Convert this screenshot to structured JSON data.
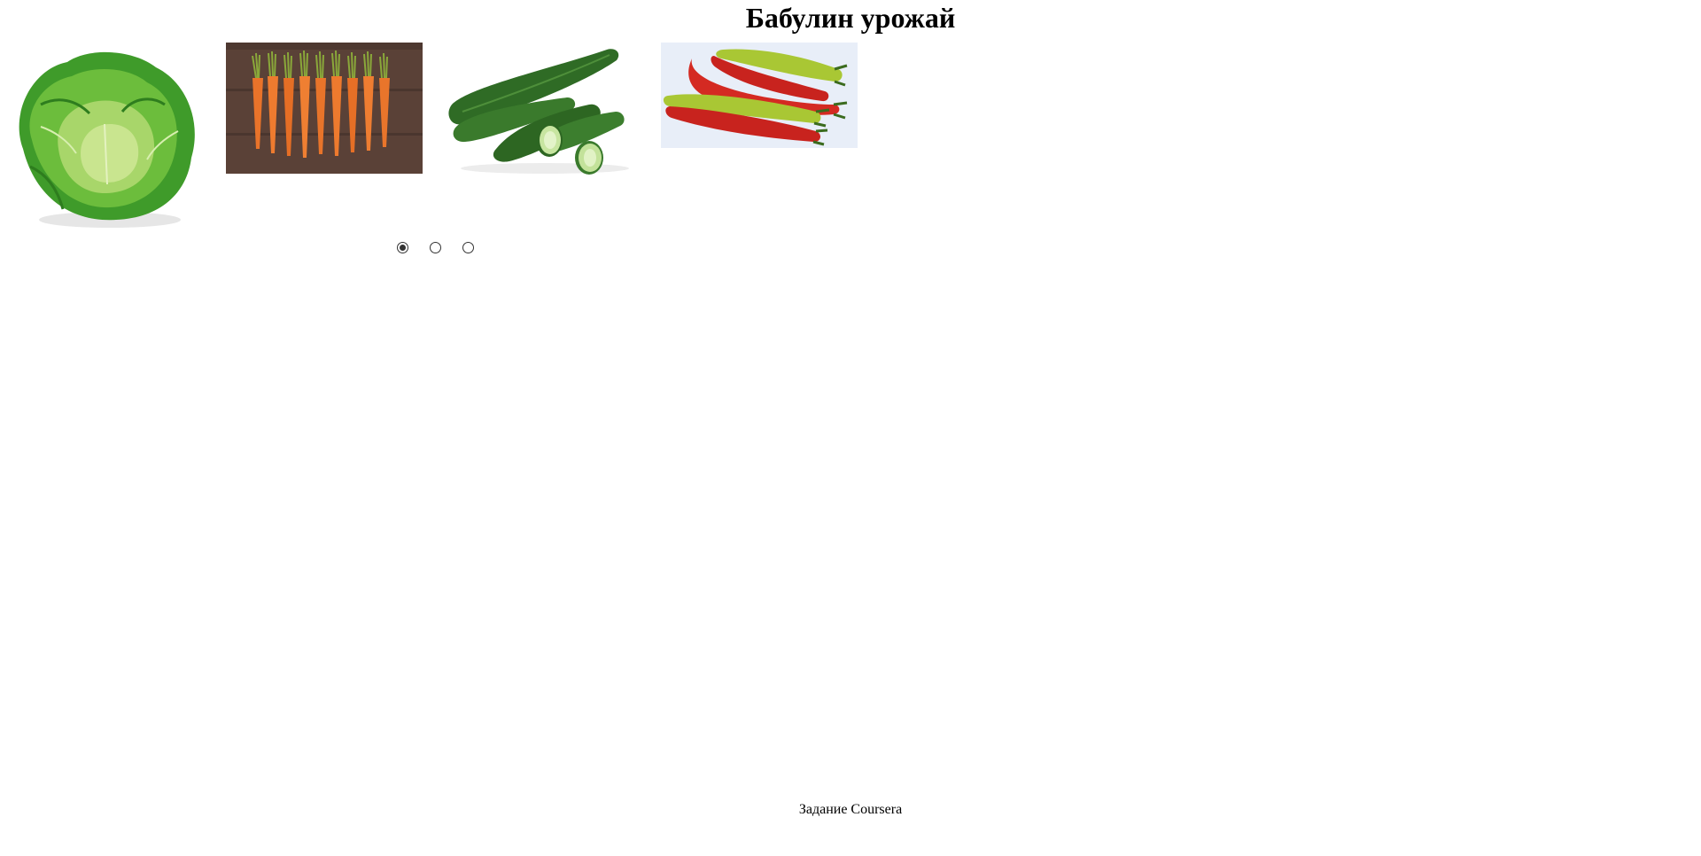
{
  "page": {
    "title": "Бабулин урожай",
    "footer_text": "Задание Coursera"
  },
  "gallery": {
    "images": [
      {
        "name": "cabbage"
      },
      {
        "name": "carrots"
      },
      {
        "name": "cucumbers"
      },
      {
        "name": "chili-peppers"
      }
    ]
  },
  "slider_nav": {
    "count": 3,
    "selected_index": 0
  },
  "colors": {
    "background": "#ffffff",
    "text": "#000000",
    "radio_border": "#333333"
  }
}
